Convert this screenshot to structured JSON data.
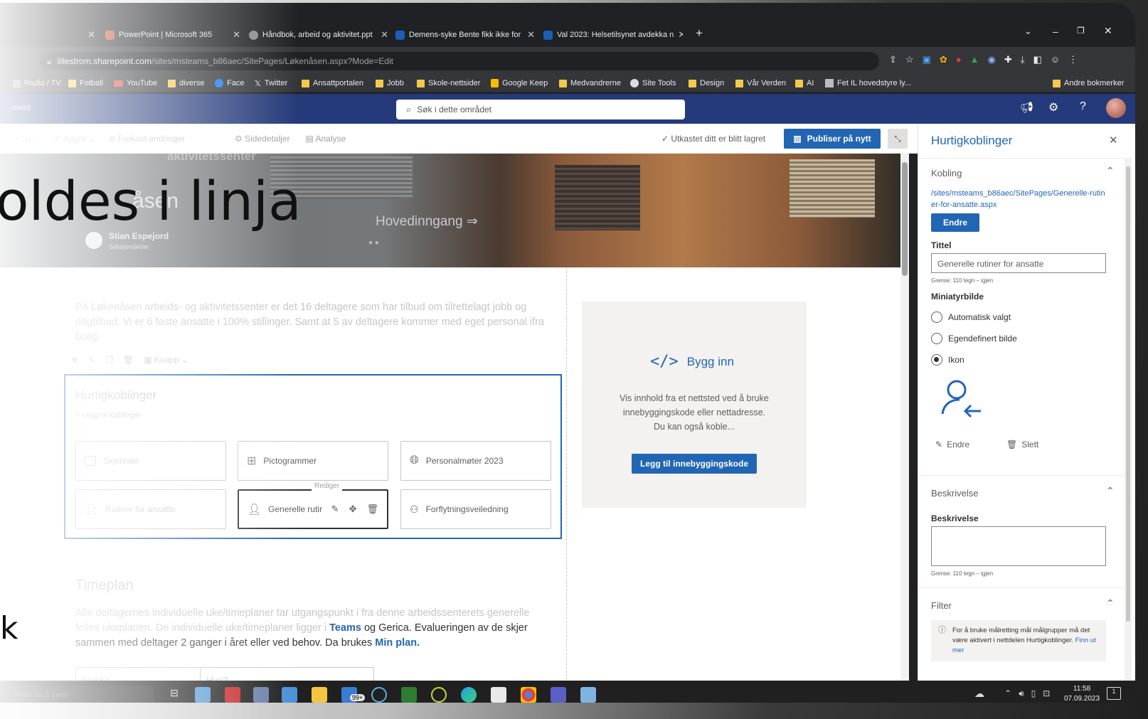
{
  "browser": {
    "tabs": [
      {
        "title": "PowerPoint | Microsoft 365",
        "color": "#c43e1c"
      },
      {
        "title": "Håndbok, arbeid og aktivitet.ppt",
        "color": "#8a8a8a"
      },
      {
        "title": "Demens-syke Bente fikk ikke for",
        "color": "#1a5fb4"
      },
      {
        "title": "Val 2023: Helsetilsynet avdekka n",
        "color": "#1a5fb4"
      }
    ],
    "url_domain": "lillestrom.sharepoint.com",
    "url_path": "/sites/msteams_b86aec/SitePages/Løkenåsen.aspx?Mode=Edit",
    "bookmarks": [
      "Radio / TV",
      "Fotball",
      "YouTube",
      "diverse",
      "Face",
      "Twitter",
      "Ansattportalen",
      "Jobb",
      "Skole-nettsider",
      "Google Keep",
      "Medvandrerne",
      "Site Tools",
      "Design",
      "Vår Verden",
      "AI",
      "Fet IL hovedstyre ly..."
    ],
    "other_bookmarks": "Andre bokmerker"
  },
  "suite": {
    "search_placeholder": "Søk i dette området",
    "app_name": "ment"
  },
  "command_bar": {
    "new": "Ny",
    "undo": "Angre",
    "discard": "Forkast endringer",
    "page_details": "Sidedetaljer",
    "analytics": "Analyse",
    "saved_status": "Utkastet ditt er blitt lagret",
    "republish": "Publiser på nytt"
  },
  "overlay": {
    "big_text": "oldes i linja",
    "k_text": "k"
  },
  "hero": {
    "building_sign": "aktivitetssenter",
    "title_fragment": "åsen",
    "author": "Stian Espejord",
    "author_role": "Seksjonsleder",
    "entrance": "Hovedinngang ⇒"
  },
  "intro_text": "På Løkenåsen arbeids- og aktivitetssenter er det 16 deltagere som har tilbud om tilrettelagt jobb og dagtilbud. Vi er 6 faste ansatte i 100% stillinger. Samt at 5 av deltagere kommer med eget personal ifra bolig.",
  "toolbar_button_label": "Knapp",
  "quicklinks": {
    "title": "Hurtigkoblinger",
    "add_link": "+ Legg til koblinger",
    "items": [
      "Skjemaer",
      "Pictogrammer",
      "Personalmøter 2023",
      "Rutiner for ansatte",
      "Generelle rutir",
      "Forflytningsveiledning"
    ],
    "tooltip": "Rediger"
  },
  "embed": {
    "title": "Bygg inn",
    "description": "Vis innhold fra et nettsted ved å bruke innebyggingskode eller nettadresse. Du kan også koble...",
    "button": "Legg til innebyggingskode"
  },
  "timeplan": {
    "heading": "Timeplan",
    "text_part1": "Alle deltagernes individuelle uke/timeplaner tar utgangspunkt i fra denne arbeidssenterets generelle felles ukeplanen. De individuelle uke/timeplaner ligger i ",
    "link_teams": "Teams",
    "text_part2": " og Gerica. Evalueringen av de skjer sammen med deltager 2 ganger i året eller ved behov. Da brukes ",
    "link_minplan": "Min plan.",
    "table_headers": [
      "Klokke",
      "Hva?"
    ]
  },
  "panel": {
    "title": "Hurtigkoblinger",
    "section_link": "Kobling",
    "link_url": "/sites/msteams_b86aec/SitePages/Generelle-rutiner-for-ansatte.aspx",
    "change_button": "Endre",
    "title_label": "Tittel",
    "title_value": "Generelle rutiner for ansatte",
    "limit_hint": "Grense: 110 tegn – igjen",
    "thumbnail_label": "Miniatyrbilde",
    "radio_auto": "Automatisk valgt",
    "radio_custom": "Egendefinert bilde",
    "radio_icon": "Ikon",
    "icon_change": "Endre",
    "icon_delete": "Slett",
    "section_description": "Beskrivelse",
    "description_label": "Beskrivelse",
    "description_value": "",
    "description_hint": "Grense: 110 tegn – igjen",
    "section_filter": "Filter",
    "filter_info": "For å bruke målretting mål målgrupper må det være aktivert i nettdelen Hurtigkoblinger.",
    "filter_link": "Finn ut mer"
  },
  "taskbar": {
    "search_placeholder": "Skriv for å søke",
    "mail_badge": "99+",
    "time": "11:58",
    "date": "07.09.2023",
    "notif_count": "1"
  },
  "colors": {
    "suite_bar": "#253a7a",
    "primary": "#2266b3",
    "taskbar": "#202020"
  }
}
